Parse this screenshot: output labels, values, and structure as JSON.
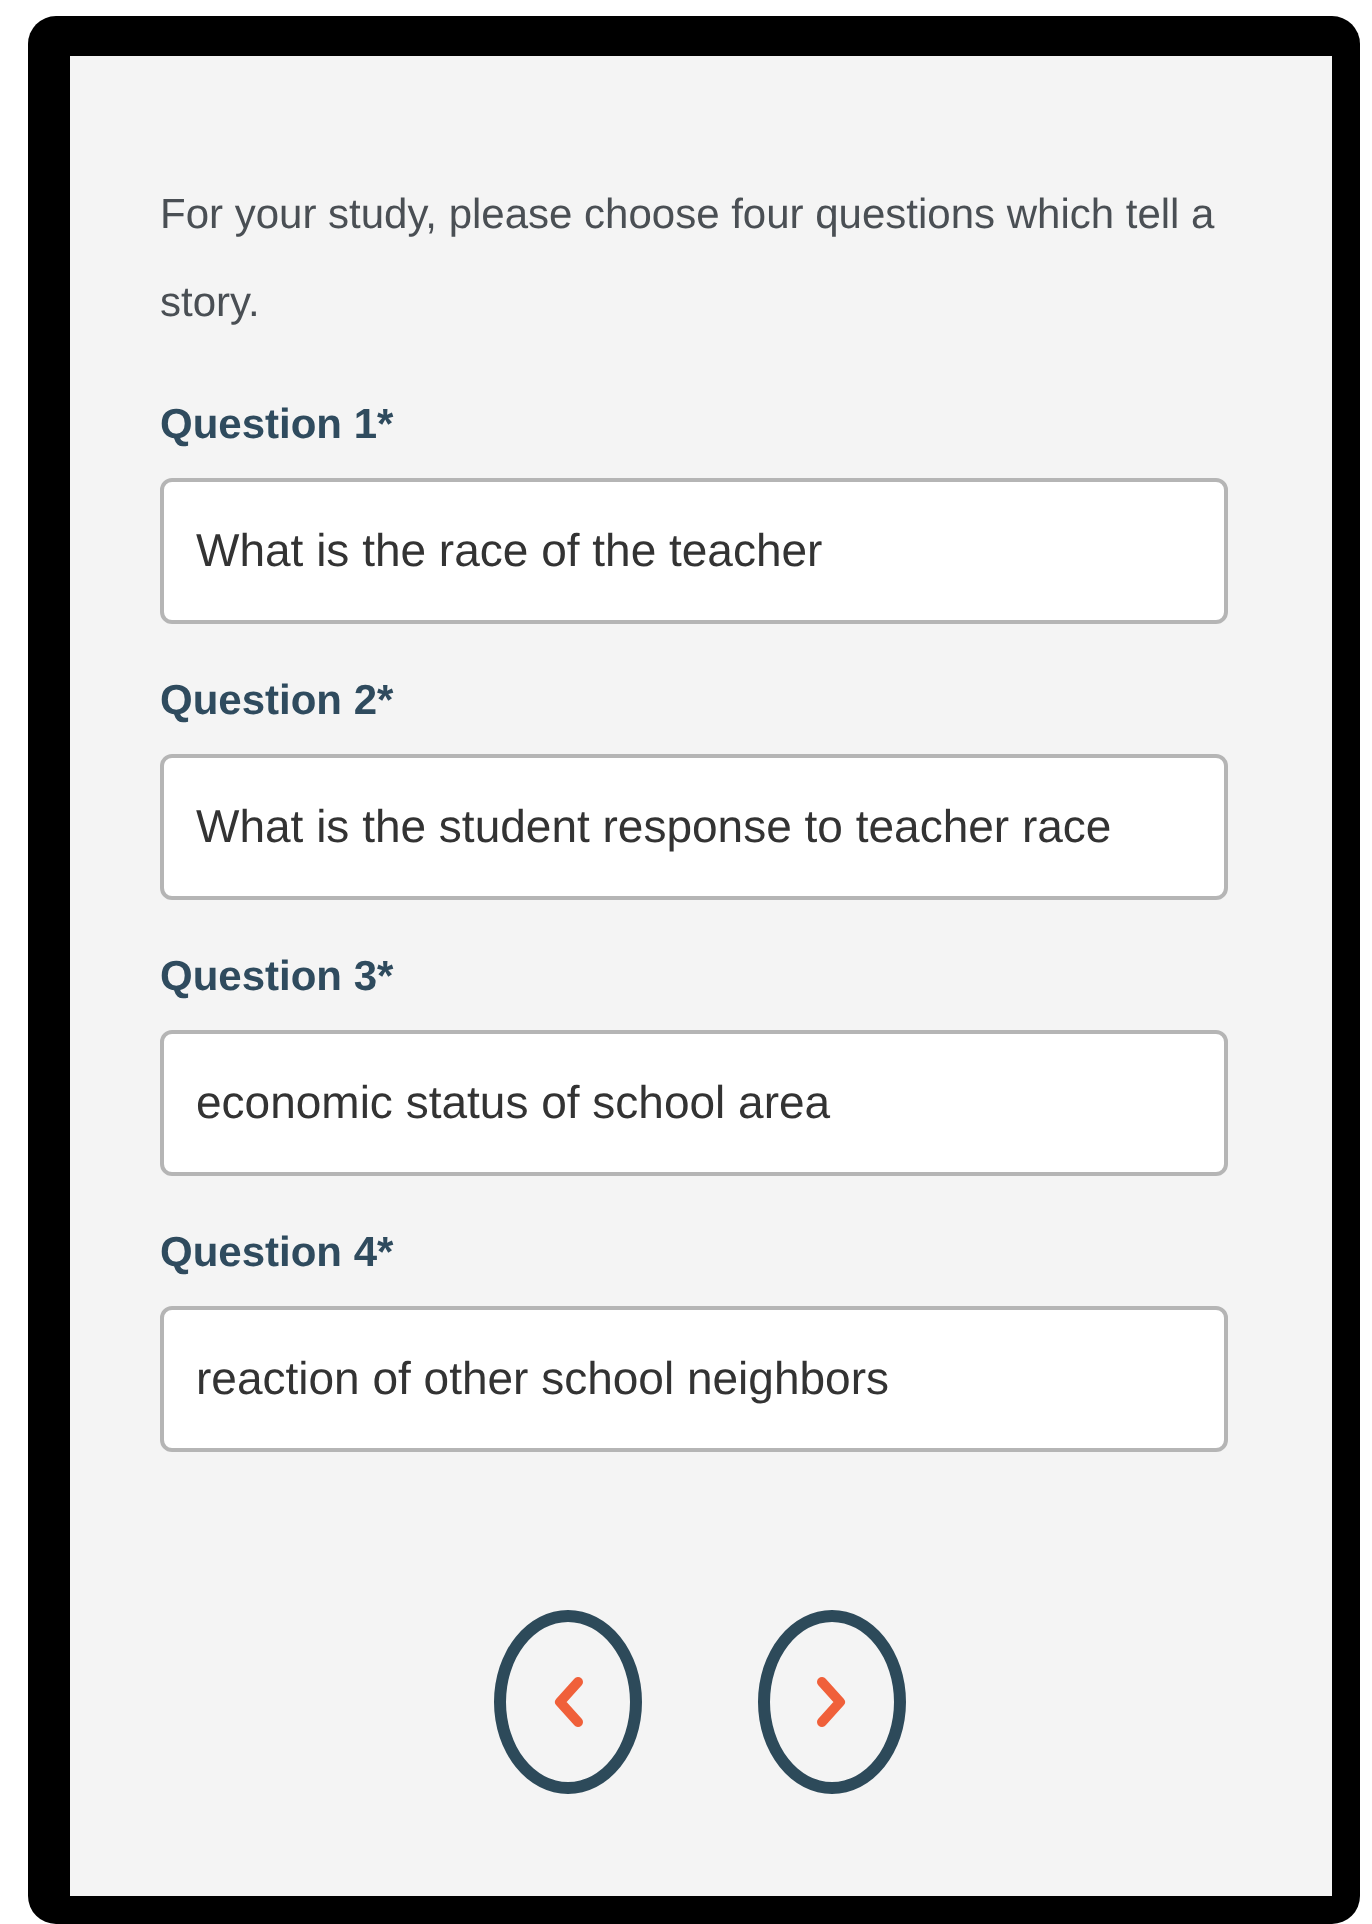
{
  "intro": "For your study, please choose four questions which tell a story.",
  "questions": [
    {
      "label": "Question 1*",
      "value": "What is the race of the teacher"
    },
    {
      "label": "Question 2*",
      "value": "What is the student response to teacher race"
    },
    {
      "label": "Question 3*",
      "value": "economic status of school area"
    },
    {
      "label": "Question 4*",
      "value": "reaction of other school neighbors"
    }
  ]
}
